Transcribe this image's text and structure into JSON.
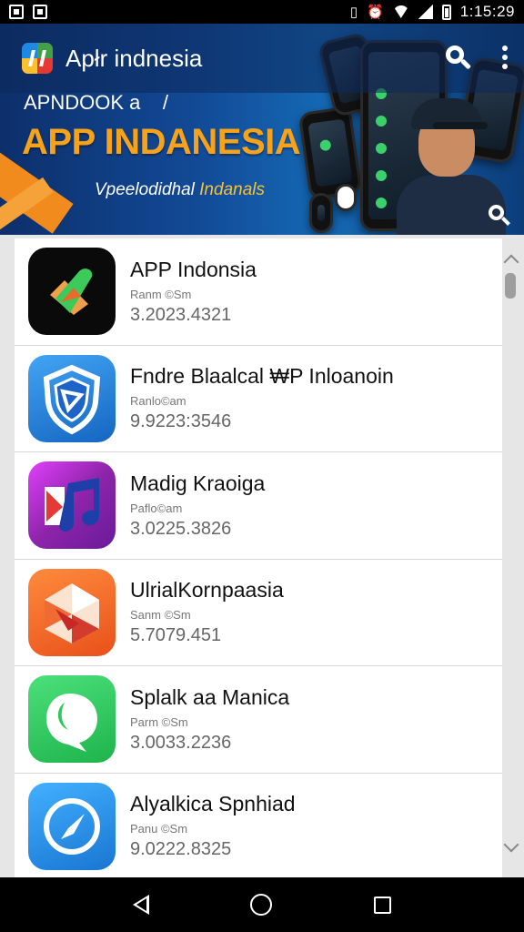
{
  "status_bar": {
    "time": "1:15:29",
    "icons": [
      "image-icon",
      "image-icon",
      "alarm-icon",
      "wifi-icon",
      "signal-icon",
      "battery-icon"
    ]
  },
  "header": {
    "title": "Apłr indnesia",
    "subtitle": "APNDOOK a    /",
    "headline": "APP INDANESIA",
    "tagline_a": "Vpeelodidhal ",
    "tagline_b": "Indanals"
  },
  "apps": [
    {
      "name": "APP Indonsia",
      "sub": "Ranm ©Sm",
      "value": "3.2023.4321",
      "icon": "check-swish-icon",
      "color_a": "#000000"
    },
    {
      "name": "Fndre Blaalcal ₩P Inloanoin",
      "sub": "Ranlo©am",
      "value": "9.9223:3546",
      "icon": "shield-icon",
      "color_a": "#1e88e5"
    },
    {
      "name": "Madig Kraoiga",
      "sub": "Paflo©am",
      "value": "3.0225.3826",
      "icon": "music-note-icon",
      "color_a": "#a626c2"
    },
    {
      "name": "UlrialKornpaasia",
      "sub": "Sanm ©Sm",
      "value": "5.7079.451",
      "icon": "puzzle-icon",
      "color_a": "#f26322"
    },
    {
      "name": "Splalk aa Manica",
      "sub": "Parm ©Sm",
      "value": "3.0033.2236",
      "icon": "chat-bubble-icon",
      "color_a": "#2ec95a"
    },
    {
      "name": "Alyalkica Spnhiad",
      "sub": "Panu ©Sm",
      "value": "9.0222.8325",
      "icon": "compass-icon",
      "color_a": "#2196f3"
    }
  ],
  "nav": {
    "back": "back-icon",
    "home": "home-icon",
    "recents": "recents-icon"
  }
}
